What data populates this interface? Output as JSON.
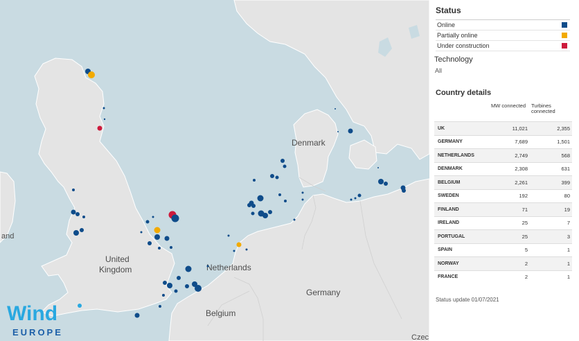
{
  "map": {
    "labels": {
      "denmark": "Denmark",
      "uk_line1": "United",
      "uk_line2": "Kingdom",
      "netherlands": "Netherlands",
      "germany": "Germany",
      "belgium": "Belgium",
      "ireland_fragment": "and",
      "czech_fragment": "Czec"
    },
    "logo": {
      "line1": "Wind",
      "line2": "EUROPE"
    },
    "colors": {
      "sea": "#c9dbe2",
      "land": "#e4e4e4",
      "online": "#0f4c8a",
      "partial": "#f2aa00",
      "construction": "#cd1a3c"
    },
    "markers": [
      {
        "status": "online",
        "size": "s"
      }
    ]
  },
  "legend": {
    "title": "Status",
    "items": [
      {
        "label": "Online",
        "color": "#0f4c8a"
      },
      {
        "label": "Partially online",
        "color": "#f2aa00"
      },
      {
        "label": "Under construction",
        "color": "#cd1a3c"
      }
    ]
  },
  "technology": {
    "title": "Technology",
    "value": "All"
  },
  "country_details": {
    "title": "Country details",
    "headers": [
      "",
      "MW connected",
      "Turbines connected"
    ],
    "rows": [
      {
        "country": "UK",
        "mw": "11,021",
        "turbines": "2,355"
      },
      {
        "country": "GERMANY",
        "mw": "7,689",
        "turbines": "1,501"
      },
      {
        "country": "NETHERLANDS",
        "mw": "2,749",
        "turbines": "568"
      },
      {
        "country": "DENMARK",
        "mw": "2,308",
        "turbines": "631"
      },
      {
        "country": "BELGIUM",
        "mw": "2,261",
        "turbines": "399"
      },
      {
        "country": "SWEDEN",
        "mw": "192",
        "turbines": "80"
      },
      {
        "country": "FINLAND",
        "mw": "71",
        "turbines": "19"
      },
      {
        "country": "IRELAND",
        "mw": "25",
        "turbines": "7"
      },
      {
        "country": "PORTUGAL",
        "mw": "25",
        "turbines": "3"
      },
      {
        "country": "SPAIN",
        "mw": "5",
        "turbines": "1"
      },
      {
        "country": "NORWAY",
        "mw": "2",
        "turbines": "1"
      },
      {
        "country": "FRANCE",
        "mw": "2",
        "turbines": "1"
      }
    ]
  },
  "status_update": "Status update 01/07/2021"
}
